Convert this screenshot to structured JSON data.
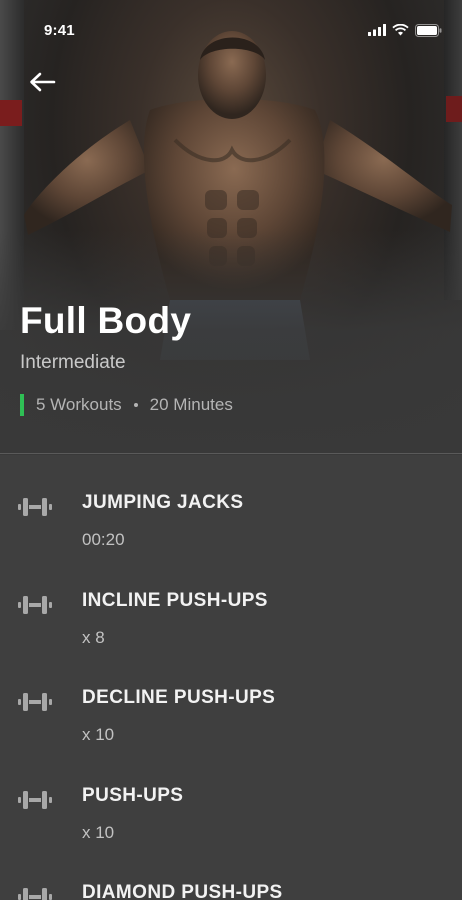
{
  "status_bar": {
    "time": "9:41"
  },
  "header": {
    "title": "Full Body",
    "level": "Intermediate",
    "workouts": "5 Workouts",
    "duration": "20 Minutes",
    "accent_color": "#2fbf55"
  },
  "exercises": [
    {
      "name": "JUMPING JACKS",
      "detail": "00:20",
      "icon": "dumbbell-icon"
    },
    {
      "name": "INCLINE PUSH-UPS",
      "detail": "x 8",
      "icon": "dumbbell-icon"
    },
    {
      "name": "DECLINE PUSH-UPS",
      "detail": "x 10",
      "icon": "dumbbell-icon"
    },
    {
      "name": "PUSH-UPS",
      "detail": "x 10",
      "icon": "dumbbell-icon"
    },
    {
      "name": "DIAMOND PUSH-UPS",
      "detail": "",
      "icon": "dumbbell-icon"
    }
  ]
}
